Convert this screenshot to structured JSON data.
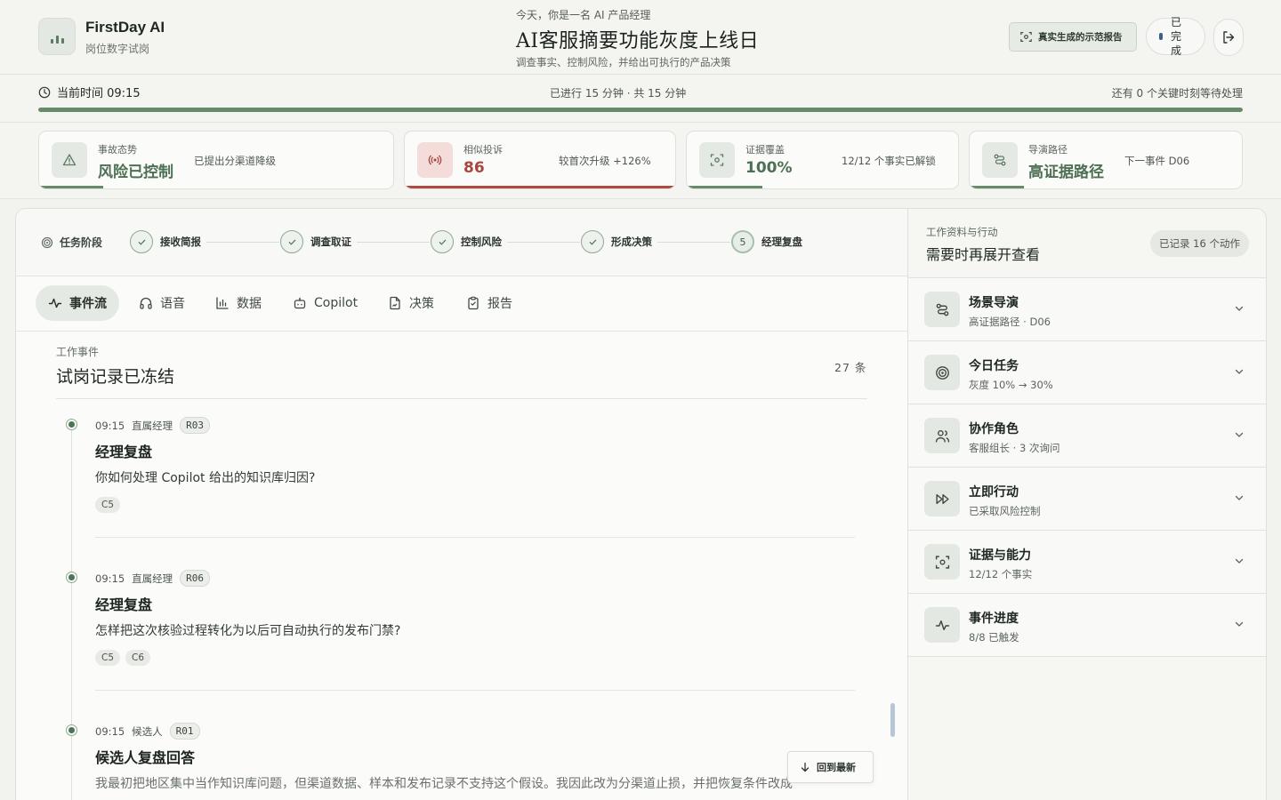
{
  "brand": {
    "name": "FirstDay AI",
    "subtitle": "岗位数字试岗"
  },
  "header": {
    "kicker": "今天，你是一名 AI 产品经理",
    "title": "AI客服摘要功能灰度上线日",
    "subtitle": "调查事实、控制风险，并给出可执行的产品决策",
    "demo_button": "真实生成的示范报告",
    "status_label": "已完成"
  },
  "timebar": {
    "current_time": "当前时间 09:15",
    "elapsed": "已进行 15 分钟 · 共 15 分钟",
    "remaining": "还有 0 个关键时刻等待处理",
    "progress_pct": 100
  },
  "stats": [
    {
      "label": "事故态势",
      "value": "风险已控制",
      "note": "已提出分渠道降级",
      "icon": "warning-icon",
      "tone": "green",
      "fill": 0.18
    },
    {
      "label": "相似投诉",
      "value": "86",
      "note": "较首次升级 +126%",
      "icon": "broadcast-icon",
      "tone": "red",
      "fill": 1.0
    },
    {
      "label": "证据覆盖",
      "value": "100%",
      "note": "12/12 个事实已解锁",
      "icon": "scan-icon",
      "tone": "green",
      "fill": 0.28
    },
    {
      "label": "导演路径",
      "value": "高证据路径",
      "note": "下一事件 D06",
      "icon": "route-icon",
      "tone": "green",
      "fill": 0.2
    }
  ],
  "stages": {
    "heading": "任务阶段",
    "items": [
      {
        "label": "接收简报",
        "state": "done"
      },
      {
        "label": "调查取证",
        "state": "done"
      },
      {
        "label": "控制风险",
        "state": "done"
      },
      {
        "label": "形成决策",
        "state": "done"
      },
      {
        "label": "经理复盘",
        "state": "current",
        "num": "5"
      }
    ]
  },
  "tabs": [
    {
      "label": "事件流",
      "icon": "activity-icon",
      "active": true
    },
    {
      "label": "语音",
      "icon": "headphones-icon"
    },
    {
      "label": "数据",
      "icon": "bar-chart-icon"
    },
    {
      "label": "Copilot",
      "icon": "bot-icon"
    },
    {
      "label": "决策",
      "icon": "file-sign-icon"
    },
    {
      "label": "报告",
      "icon": "clipboard-icon"
    }
  ],
  "feed": {
    "kicker": "工作事件",
    "title": "试岗记录已冻结",
    "count": "27 条",
    "events": [
      {
        "time": "09:15",
        "role": "直属经理",
        "tag": "R03",
        "title": "经理复盘",
        "body": "你如何处理 Copilot 给出的知识库归因?",
        "chips": [
          "C5"
        ]
      },
      {
        "time": "09:15",
        "role": "直属经理",
        "tag": "R06",
        "title": "经理复盘",
        "body": "怎样把这次核验过程转化为以后可自动执行的发布门禁?",
        "chips": [
          "C5",
          "C6"
        ]
      },
      {
        "time": "09:15",
        "role": "候选人",
        "tag": "R01",
        "title": "候选人复盘回答",
        "body": "我最初把地区集中当作知识库问题，但渠道数据、样本和发布记录不支持这个假设。我因此改为分渠道止损，并把恢复条件改成",
        "chips": []
      }
    ],
    "jump_latest": "回到最新"
  },
  "side": {
    "kicker": "工作资料与行动",
    "title": "需要时再展开查看",
    "badge": "已记录 16 个动作",
    "items": [
      {
        "title": "场景导演",
        "sub": "高证据路径 · D06",
        "icon": "route-icon"
      },
      {
        "title": "今日任务",
        "sub": "灰度 10% → 30%",
        "icon": "target-icon"
      },
      {
        "title": "协作角色",
        "sub": "客服组长 · 3 次询问",
        "icon": "users-icon"
      },
      {
        "title": "立即行动",
        "sub": "已采取风险控制",
        "icon": "fast-forward-icon"
      },
      {
        "title": "证据与能力",
        "sub": "12/12 个事实",
        "icon": "scan-icon"
      },
      {
        "title": "事件进度",
        "sub": "8/8 已触发",
        "icon": "activity-icon"
      }
    ]
  }
}
